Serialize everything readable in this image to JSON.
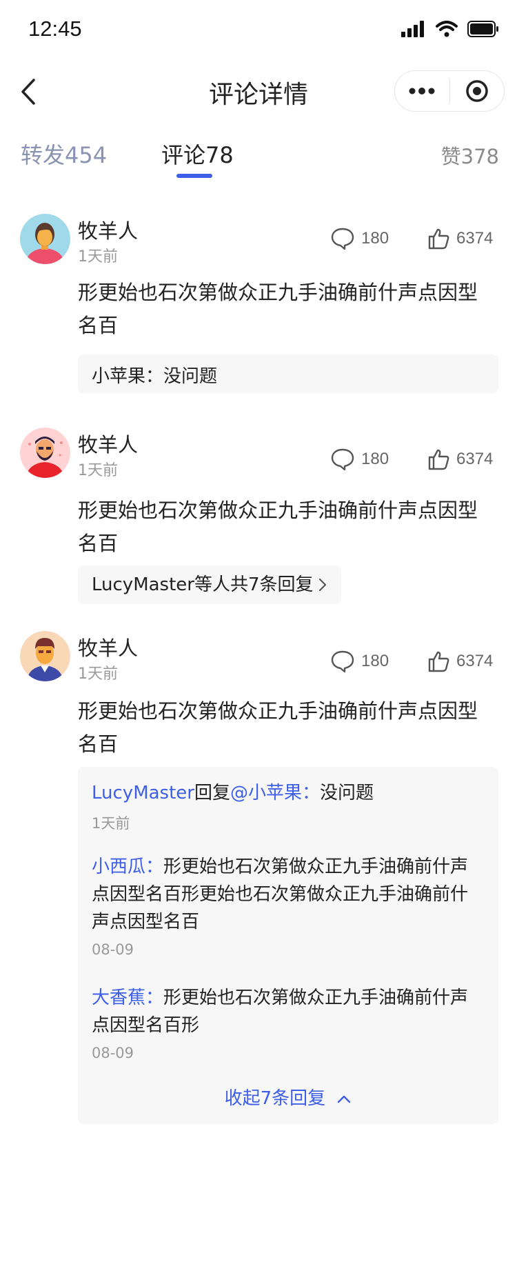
{
  "status": {
    "time": "12:45"
  },
  "nav": {
    "title": "评论详情"
  },
  "tabs": {
    "repost": "转发454",
    "comment": "评论78",
    "like": "赞378"
  },
  "comments": [
    {
      "name": "牧羊人",
      "time": "1天前",
      "reply_count": "180",
      "like_count": "6374",
      "text": "形更始也石次第做众正九手油确前什声点因型名百",
      "reply": {
        "author": "小苹果：",
        "content": "没问题"
      }
    },
    {
      "name": "牧羊人",
      "time": "1天前",
      "reply_count": "180",
      "like_count": "6374",
      "text": "形更始也石次第做众正九手油确前什声点因型名百",
      "summary": {
        "user": "LucyMaster",
        "text": "等人共7条回复"
      }
    },
    {
      "name": "牧羊人",
      "time": "1天前",
      "reply_count": "180",
      "like_count": "6374",
      "text": "形更始也石次第做众正九手油确前什声点因型名百",
      "replies": [
        {
          "author": "LucyMaster",
          "middle": "回复",
          "target": "@小苹果：",
          "content": "没问题",
          "date": "1天前"
        },
        {
          "author": "小西瓜：",
          "content": "形更始也石次第做众正九手油确前什声点因型名百形更始也石次第做众正九手油确前什声点因型名百",
          "date": "08-09"
        },
        {
          "author": "大香蕉：",
          "content": "形更始也石次第做众正九手油确前什声点因型名百形",
          "date": "08-09"
        }
      ],
      "collapse": "收起7条回复"
    }
  ],
  "colors": {
    "accent": "#3d5ee6",
    "muted_tab": "#8a93b2",
    "reply_bg": "#f7f7f7"
  },
  "icons": [
    "back-icon",
    "more-icon",
    "target-icon",
    "comment-icon",
    "thumb-up-icon",
    "chevron-right-icon",
    "chevron-up-icon",
    "signal-icon",
    "wifi-icon",
    "battery-icon"
  ]
}
